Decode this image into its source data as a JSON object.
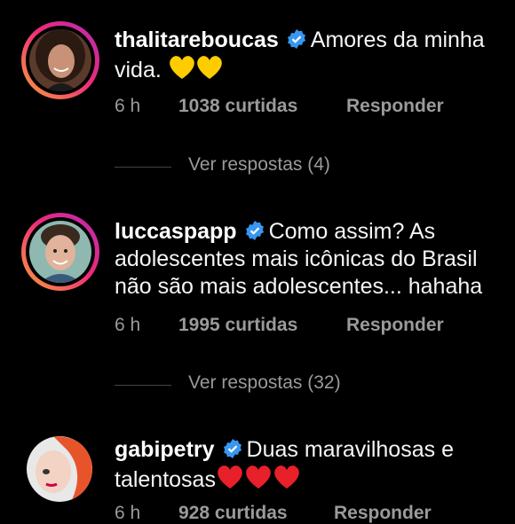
{
  "comments": [
    {
      "username": "thalitareboucas",
      "text_line1": "Amores da minha",
      "text_line2": "vida.",
      "emoji_after": "yellow-hearts",
      "time": "6 h",
      "likes": "1038 curtidas",
      "reply": "Responder",
      "view_replies": "Ver respostas (4)"
    },
    {
      "username": "luccaspapp",
      "text_line1": "Como assim? As",
      "text_line2": "adolescentes mais icônicas do Brasil",
      "text_line3": "não são mais adolescentes... hahaha",
      "time": "6 h",
      "likes": "1995 curtidas",
      "reply": "Responder",
      "view_replies": "Ver respostas (32)"
    },
    {
      "username": "gabipetry",
      "text_line1": "Duas maravilhosas e",
      "text_line2": "talentosas",
      "emoji_after": "red-hearts",
      "time": "6 h",
      "likes": "928 curtidas",
      "reply": "Responder"
    }
  ],
  "colors": {
    "background": "#000000",
    "text": "#f5f5f5",
    "muted": "#9a9a9a",
    "verified": "#3897f0",
    "story_ring": "#ee2a7b"
  }
}
